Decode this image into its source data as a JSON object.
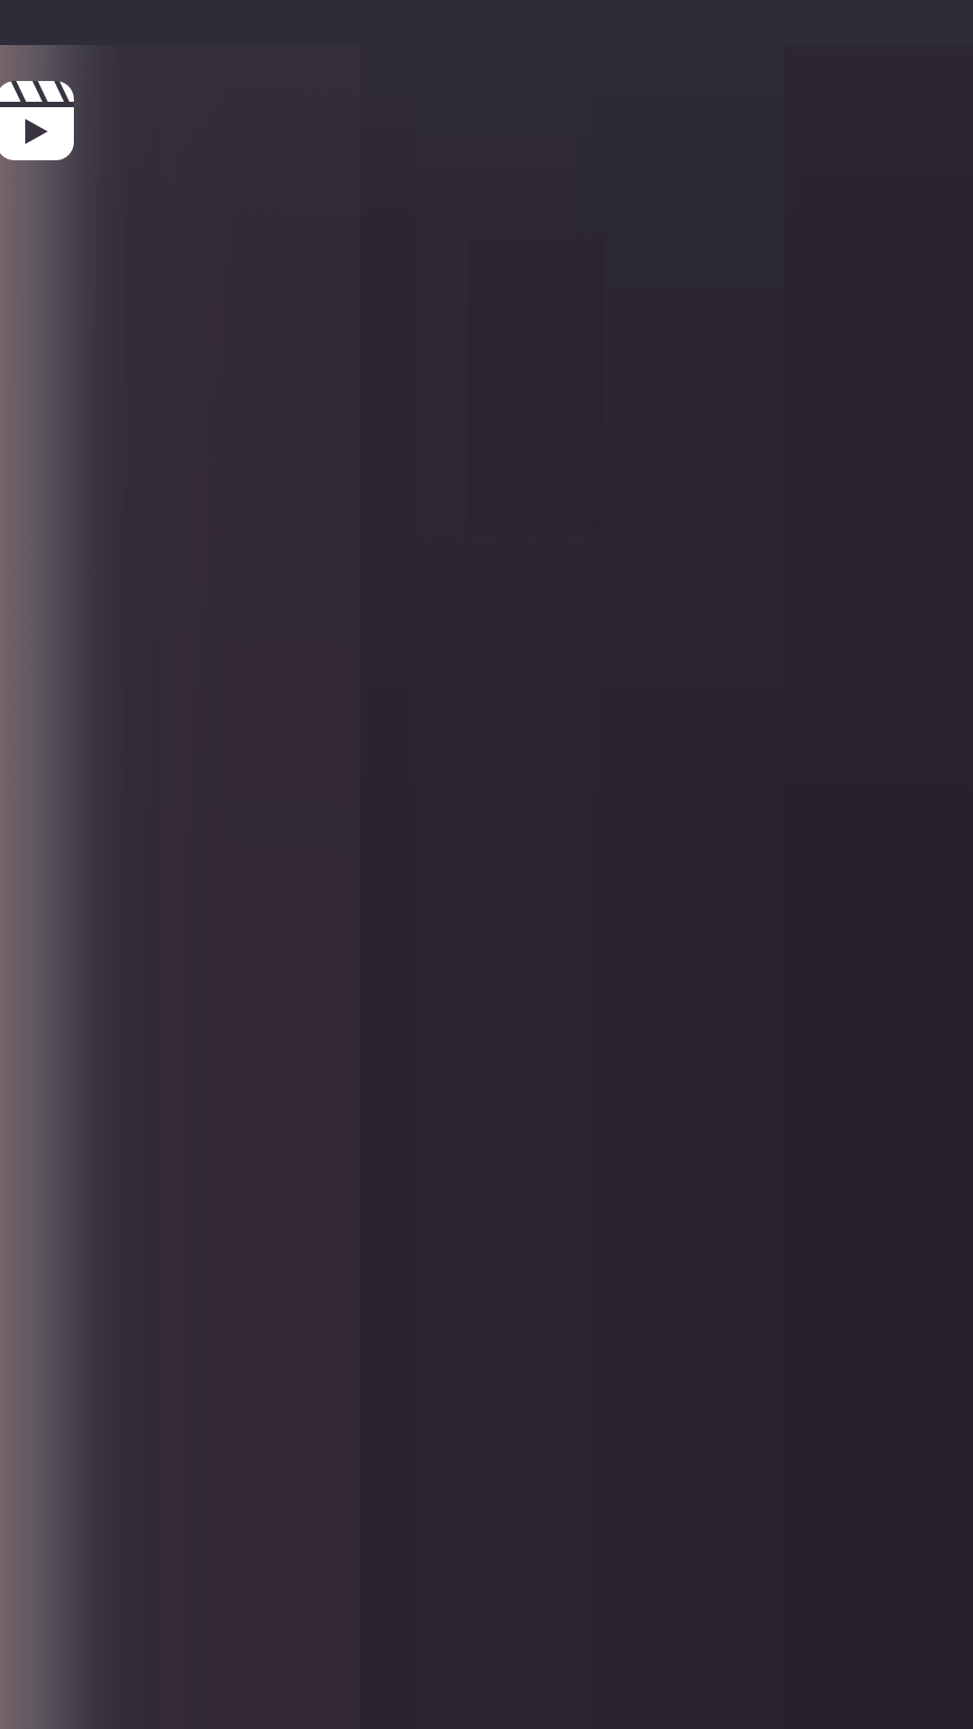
{
  "screen": {
    "type": "reels-video-loading",
    "background_color": "#2b2330",
    "top_bar_color": "#2e2c38"
  },
  "icons": {
    "reels": "reels-icon"
  }
}
